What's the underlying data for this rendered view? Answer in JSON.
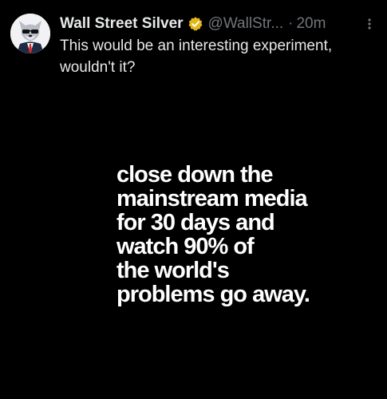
{
  "tweet": {
    "display_name": "Wall Street Silver",
    "handle": "@WallStr...",
    "separator": "·",
    "time": "20m",
    "text": "This would be an interesting experiment, wouldn't it?",
    "image_text": "close down the\nmainstream media\nfor 30 days and\nwatch 90% of\nthe world's\nproblems go away."
  },
  "icons": {
    "verified": "verified-badge-icon",
    "more": "more-options-icon",
    "avatar": "wolf-in-suit-avatar"
  },
  "colors": {
    "background": "#000000",
    "primary_text": "#e7e9ea",
    "secondary_text": "#71767b",
    "verified_gold": "#e2b719",
    "image_text": "#ffffff"
  }
}
